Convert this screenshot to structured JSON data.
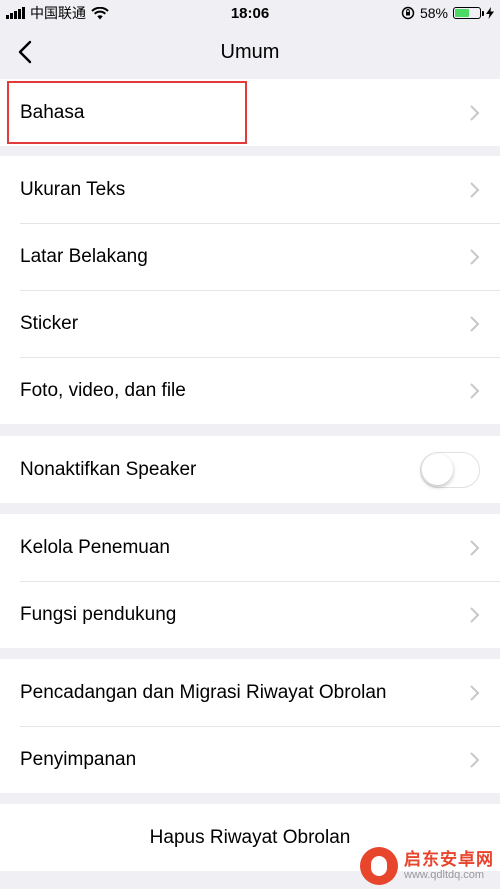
{
  "status": {
    "carrier": "中国联通",
    "time": "18:06",
    "battery_percent": "58%",
    "battery_level": 0.58,
    "battery_color": "#4cd964"
  },
  "nav": {
    "title": "Umum",
    "back_icon": "chevron-left-icon"
  },
  "groups": [
    {
      "items": [
        {
          "label": "Bahasa",
          "accessory": "chevron"
        }
      ]
    },
    {
      "items": [
        {
          "label": "Ukuran Teks",
          "accessory": "chevron"
        },
        {
          "label": "Latar Belakang",
          "accessory": "chevron"
        },
        {
          "label": "Sticker",
          "accessory": "chevron"
        },
        {
          "label": "Foto, video, dan file",
          "accessory": "chevron"
        }
      ]
    },
    {
      "items": [
        {
          "label": "Nonaktifkan Speaker",
          "accessory": "toggle",
          "toggle_on": false
        }
      ]
    },
    {
      "items": [
        {
          "label": "Kelola Penemuan",
          "accessory": "chevron"
        },
        {
          "label": "Fungsi pendukung",
          "accessory": "chevron"
        }
      ]
    },
    {
      "items": [
        {
          "label": "Pencadangan dan Migrasi Riwayat Obrolan",
          "accessory": "chevron"
        },
        {
          "label": "Penyimpanan",
          "accessory": "chevron"
        }
      ]
    }
  ],
  "clear_history": {
    "label": "Hapus Riwayat Obrolan"
  },
  "highlight_color": "#e33b3b",
  "watermark": {
    "title": "启东安卓网",
    "url": "www.qdltdq.com"
  }
}
